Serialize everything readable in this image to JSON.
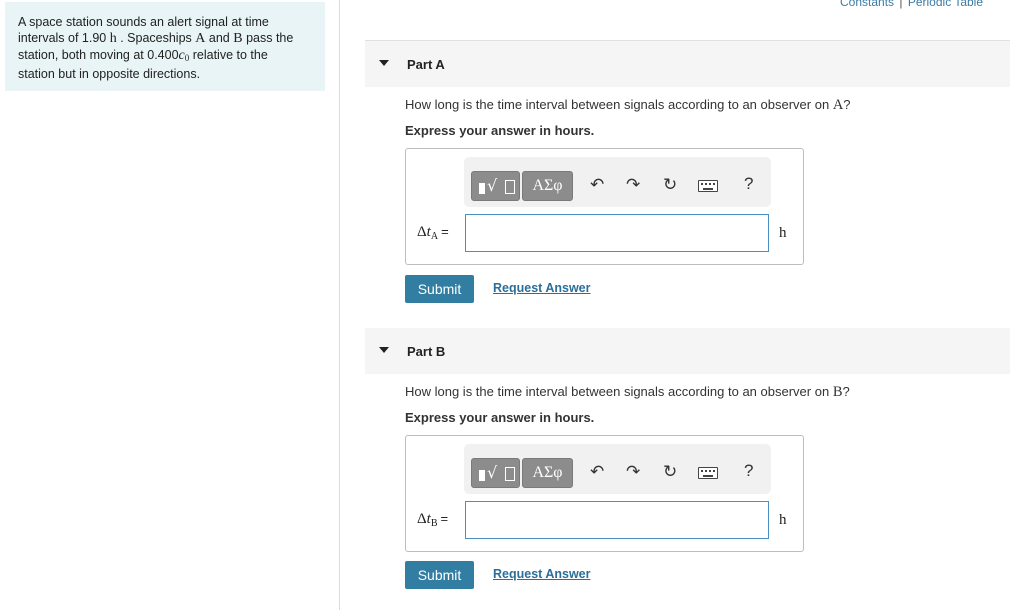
{
  "problem": {
    "text_1": "A space station sounds an alert signal at time",
    "text_2": "intervals of 1.90",
    "unit_h": "h",
    "text_3": ". Spaceships",
    "ship_a": "A",
    "text_4": "and",
    "ship_b": "B",
    "text_5": "pass the",
    "text_6": "station, both moving at 0.400",
    "c0": "c",
    "c0_sub": "0",
    "text_7": "relative to the",
    "text_8": "station but in opposite directions."
  },
  "top_links": {
    "constants": "Constants",
    "separator": "|",
    "periodic_table": "Periodic Table"
  },
  "parts": [
    {
      "title": "Part A",
      "question_prefix": "How long is the time interval between signals according to an observer on",
      "question_var": "A",
      "question_suffix": "?",
      "instruction": "Express your answer in hours.",
      "var_delta": "Δ",
      "var_t": "t",
      "var_sub": "A",
      "equals": "=",
      "input_value": "",
      "unit": "h",
      "submit_label": "Submit",
      "request_label": "Request Answer"
    },
    {
      "title": "Part B",
      "question_prefix": "How long is the time interval between signals according to an observer on",
      "question_var": "B",
      "question_suffix": "?",
      "instruction": "Express your answer in hours.",
      "var_delta": "Δ",
      "var_t": "t",
      "var_sub": "B",
      "equals": "=",
      "input_value": "",
      "unit": "h",
      "submit_label": "Submit",
      "request_label": "Request Answer"
    }
  ],
  "toolbar": {
    "templates_icon": "templates-icon",
    "symbols_label": "ΑΣφ",
    "undo_glyph": "↶",
    "redo_glyph": "↷",
    "reset_glyph": "↻",
    "keyboard_icon": "keyboard-icon",
    "help_label": "?"
  }
}
